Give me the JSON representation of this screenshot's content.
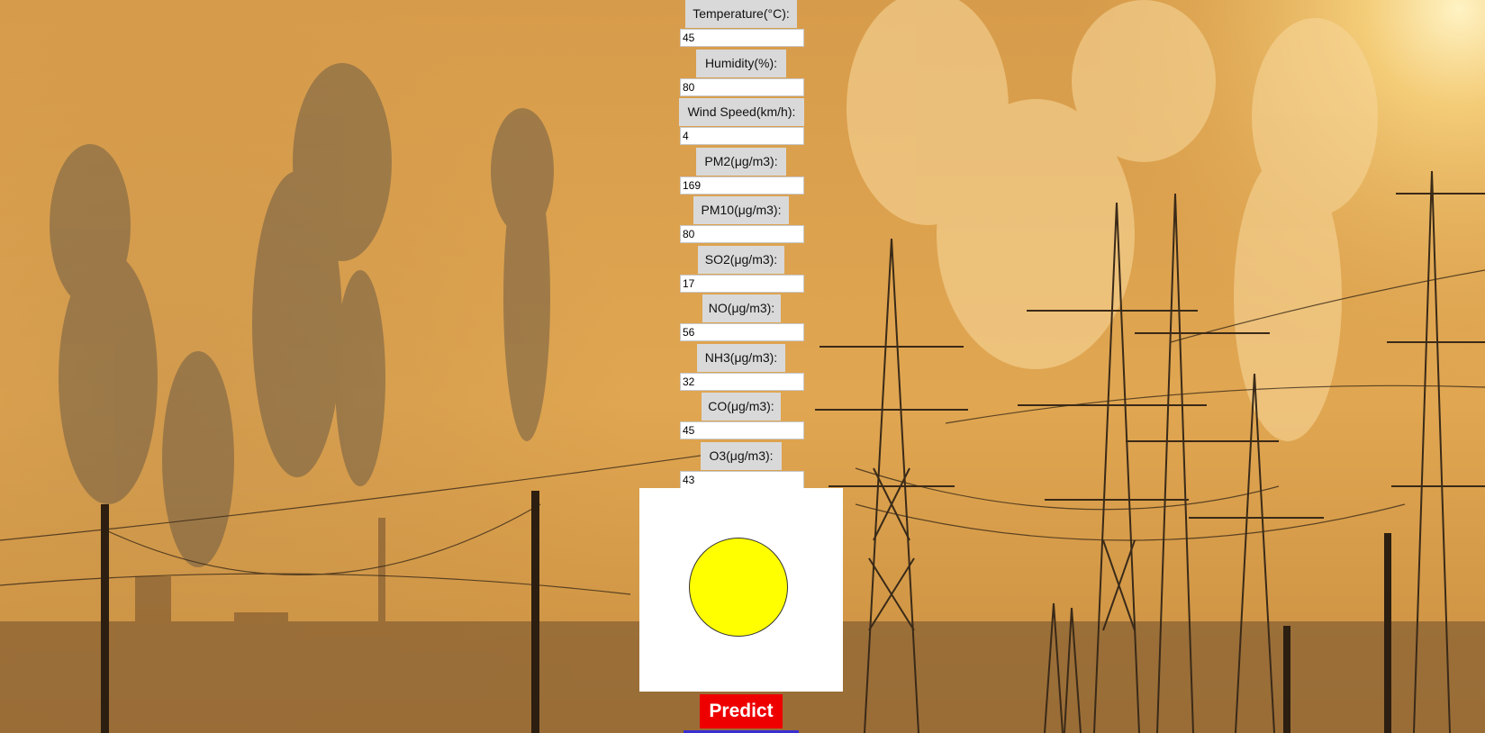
{
  "colors": {
    "sky_top": "#d99d4a",
    "sky_glow": "#f3c36a",
    "smoke": "#6b5a45",
    "steam": "#f4d39a",
    "pylon": "#3a2a18",
    "label_bg": "#d9d9d9",
    "indicator_fill": "#ffff00",
    "predict_bg": "#ee0000",
    "predict_text": "#ffffff"
  },
  "form": {
    "fields": [
      {
        "label": "Temperature(°C):",
        "value": "45"
      },
      {
        "label": "Humidity(%):",
        "value": "80"
      },
      {
        "label": "Wind Speed(km/h):",
        "value": "4"
      },
      {
        "label": "PM2(μg/m3):",
        "value": "169"
      },
      {
        "label": "PM10(μg/m3):",
        "value": "80"
      },
      {
        "label": "SO2(μg/m3):",
        "value": "17"
      },
      {
        "label": "NO(μg/m3):",
        "value": "56"
      },
      {
        "label": "NH3(μg/m3):",
        "value": "32"
      },
      {
        "label": "CO(μg/m3):",
        "value": "45"
      },
      {
        "label": "O3(μg/m3):",
        "value": "43"
      }
    ]
  },
  "result": {
    "indicator_color": "#ffff00"
  },
  "actions": {
    "predict_label": "Predict"
  }
}
